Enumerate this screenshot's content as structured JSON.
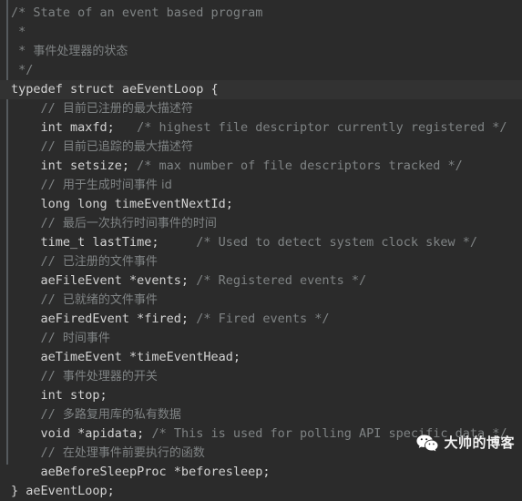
{
  "editor": {
    "language": "c",
    "background_color": "#2b2b2b",
    "code_color": "#d4d4d4",
    "comment_color": "#7f8384",
    "highlight_color": "#323232",
    "gutter_rule_color": "#555a5e"
  },
  "code": {
    "lines": [
      {
        "n": 1,
        "indent": 0,
        "highlight": false,
        "segments": [
          {
            "kind": "comment",
            "text": "/* State of an event based program"
          }
        ]
      },
      {
        "n": 2,
        "indent": 0,
        "highlight": false,
        "segments": [
          {
            "kind": "comment",
            "text": " *"
          }
        ]
      },
      {
        "n": 3,
        "indent": 0,
        "highlight": false,
        "segments": [
          {
            "kind": "comment",
            "text": " * "
          },
          {
            "kind": "cn",
            "text": "事件处理器的状态"
          }
        ]
      },
      {
        "n": 4,
        "indent": 0,
        "highlight": false,
        "segments": [
          {
            "kind": "comment",
            "text": " */"
          }
        ]
      },
      {
        "n": 5,
        "indent": 0,
        "highlight": true,
        "segments": [
          {
            "kind": "code",
            "text": "typedef struct aeEventLoop {"
          }
        ]
      },
      {
        "n": 6,
        "indent": 0,
        "highlight": false,
        "segments": [
          {
            "kind": "comment",
            "text": "    // "
          },
          {
            "kind": "cn",
            "text": "目前已注册的最大描述符"
          }
        ]
      },
      {
        "n": 7,
        "indent": 0,
        "highlight": false,
        "segments": [
          {
            "kind": "code",
            "text": "    int maxfd;   "
          },
          {
            "kind": "comment",
            "text": "/* highest file descriptor currently registered */"
          }
        ]
      },
      {
        "n": 8,
        "indent": 0,
        "highlight": false,
        "segments": [
          {
            "kind": "comment",
            "text": "    // "
          },
          {
            "kind": "cn",
            "text": "目前已追踪的最大描述符"
          }
        ]
      },
      {
        "n": 9,
        "indent": 0,
        "highlight": false,
        "segments": [
          {
            "kind": "code",
            "text": "    int setsize; "
          },
          {
            "kind": "comment",
            "text": "/* max number of file descriptors tracked */"
          }
        ]
      },
      {
        "n": 10,
        "indent": 0,
        "highlight": false,
        "segments": [
          {
            "kind": "comment",
            "text": "    // "
          },
          {
            "kind": "cn",
            "text": "用于生成时间事件 id"
          }
        ]
      },
      {
        "n": 11,
        "indent": 0,
        "highlight": false,
        "segments": [
          {
            "kind": "code",
            "text": "    long long timeEventNextId;"
          }
        ]
      },
      {
        "n": 12,
        "indent": 0,
        "highlight": false,
        "segments": [
          {
            "kind": "comment",
            "text": "    // "
          },
          {
            "kind": "cn",
            "text": "最后一次执行时间事件的时间"
          }
        ]
      },
      {
        "n": 13,
        "indent": 0,
        "highlight": false,
        "segments": [
          {
            "kind": "code",
            "text": "    time_t lastTime;     "
          },
          {
            "kind": "comment",
            "text": "/* Used to detect system clock skew */"
          }
        ]
      },
      {
        "n": 14,
        "indent": 0,
        "highlight": false,
        "segments": [
          {
            "kind": "comment",
            "text": "    // "
          },
          {
            "kind": "cn",
            "text": "已注册的文件事件"
          }
        ]
      },
      {
        "n": 15,
        "indent": 0,
        "highlight": false,
        "segments": [
          {
            "kind": "code",
            "text": "    aeFileEvent *events; "
          },
          {
            "kind": "comment",
            "text": "/* Registered events */"
          }
        ]
      },
      {
        "n": 16,
        "indent": 0,
        "highlight": false,
        "segments": [
          {
            "kind": "comment",
            "text": "    // "
          },
          {
            "kind": "cn",
            "text": "已就绪的文件事件"
          }
        ]
      },
      {
        "n": 17,
        "indent": 0,
        "highlight": false,
        "segments": [
          {
            "kind": "code",
            "text": "    aeFiredEvent *fired; "
          },
          {
            "kind": "comment",
            "text": "/* Fired events */"
          }
        ]
      },
      {
        "n": 18,
        "indent": 0,
        "highlight": false,
        "segments": [
          {
            "kind": "comment",
            "text": "    // "
          },
          {
            "kind": "cn",
            "text": "时间事件"
          }
        ]
      },
      {
        "n": 19,
        "indent": 0,
        "highlight": false,
        "segments": [
          {
            "kind": "code",
            "text": "    aeTimeEvent *timeEventHead;"
          }
        ]
      },
      {
        "n": 20,
        "indent": 0,
        "highlight": false,
        "segments": [
          {
            "kind": "comment",
            "text": "    // "
          },
          {
            "kind": "cn",
            "text": "事件处理器的开关"
          }
        ]
      },
      {
        "n": 21,
        "indent": 0,
        "highlight": false,
        "segments": [
          {
            "kind": "code",
            "text": "    int stop;"
          }
        ]
      },
      {
        "n": 22,
        "indent": 0,
        "highlight": false,
        "segments": [
          {
            "kind": "comment",
            "text": "    // "
          },
          {
            "kind": "cn",
            "text": "多路复用库的私有数据"
          }
        ]
      },
      {
        "n": 23,
        "indent": 0,
        "highlight": false,
        "segments": [
          {
            "kind": "code",
            "text": "    void *apidata; "
          },
          {
            "kind": "comment",
            "text": "/* This is used for polling API specific data */"
          }
        ]
      },
      {
        "n": 24,
        "indent": 0,
        "highlight": false,
        "segments": [
          {
            "kind": "comment",
            "text": "    // "
          },
          {
            "kind": "cn",
            "text": "在处理事件前要执行的函数"
          }
        ]
      },
      {
        "n": 25,
        "indent": 0,
        "highlight": false,
        "segments": [
          {
            "kind": "code",
            "text": "    aeBeforeSleepProc *beforesleep;"
          }
        ]
      },
      {
        "n": 26,
        "indent": 0,
        "highlight": false,
        "segments": [
          {
            "kind": "code",
            "text": "} aeEventLoop;"
          }
        ]
      }
    ]
  },
  "watermark": {
    "icon": "wechat-icon",
    "label": "大帅的博客",
    "text_color": "#f2f2f2",
    "icon_color": "#ffffff"
  }
}
